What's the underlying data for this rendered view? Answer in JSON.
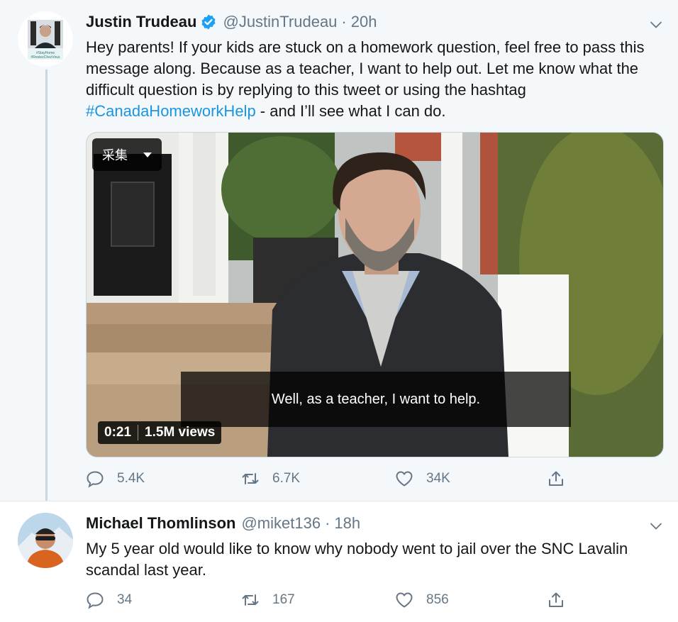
{
  "tweets": [
    {
      "name": "Justin Trudeau",
      "verified": true,
      "handle": "@JustinTrudeau",
      "separator": "·",
      "time": "20h",
      "text_before": "Hey parents! If your kids are stuck on a homework question, feel free to pass this message along. Because as a teacher, I want to help out. Let me know what the difficult question is by replying to this tweet or using the hashtag ",
      "hashtag": "#CanadaHomeworkHelp",
      "text_after": " - and I’ll see what I can do.",
      "avatar_caption": "#StayHome #RestezChezVous",
      "video": {
        "collect_label": "采集",
        "subtitle": "Well, as a teacher, I want to help.",
        "duration": "0:21",
        "views": "1.5M views"
      },
      "stats": {
        "replies": "5.4K",
        "retweets": "6.7K",
        "likes": "34K"
      }
    },
    {
      "name": "Michael Thomlinson",
      "handle": "@miket136",
      "separator": "·",
      "time": "18h",
      "text": "My 5 year old would like to know why nobody went to jail over the SNC Lavalin scandal last year.",
      "stats": {
        "replies": "34",
        "retweets": "167",
        "likes": "856"
      }
    }
  ],
  "colors": {
    "link": "#1b95e0",
    "verified": "#1da1f2",
    "muted": "#657786",
    "thread_line": "#ccd6dd"
  },
  "icons": [
    "verified-badge-icon",
    "chevron-down-icon",
    "reply-icon",
    "retweet-icon",
    "heart-icon",
    "share-icon",
    "dropdown-caret-icon"
  ]
}
